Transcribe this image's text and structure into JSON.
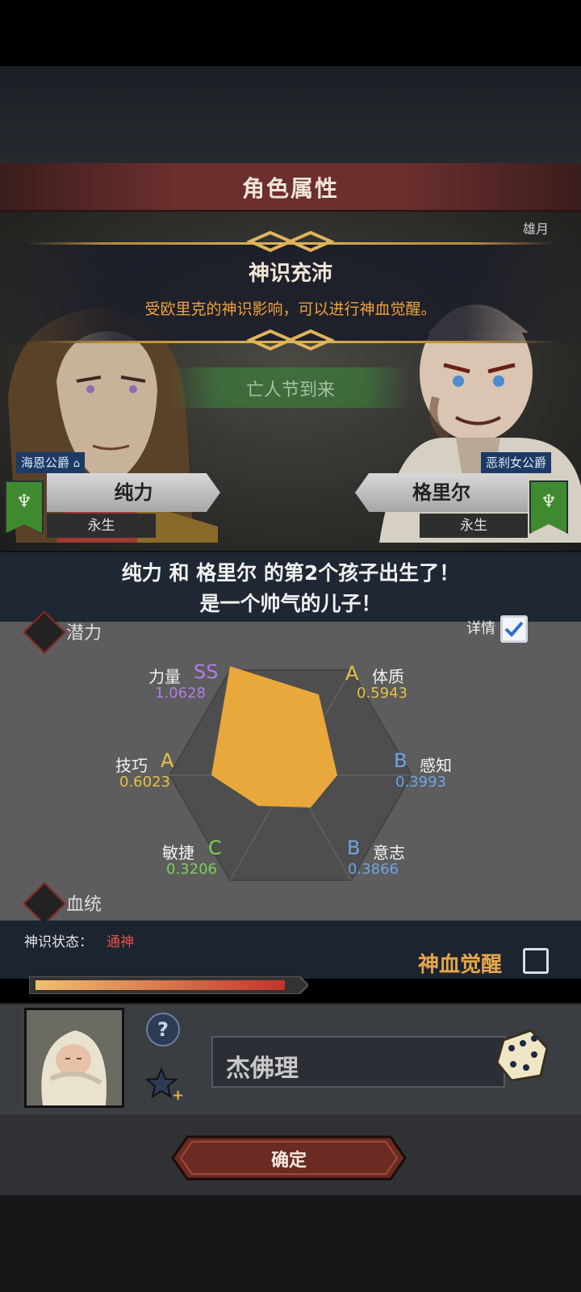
{
  "header": {
    "title": "角色属性"
  },
  "banner": {
    "title": "神识充沛",
    "description": "受欧里克的神识影响，可以进行神血觉醒。"
  },
  "festival": {
    "label": "亡人节到来"
  },
  "scene": {
    "corner_text": "雄月"
  },
  "father": {
    "title": "海恩公爵",
    "name": "纯力",
    "status": "永生"
  },
  "mother": {
    "title": "恶刹女公爵",
    "name": "格里尔",
    "status": "永生"
  },
  "announcement": {
    "line1": "纯力 和 格里尔 的第2个孩子出生了！",
    "line2": "是一个帅气的儿子！"
  },
  "potential": {
    "section_label": "潜力",
    "detail_label": "详情",
    "stats": [
      {
        "name": "力量",
        "grade": "SS",
        "value": "1.0628"
      },
      {
        "name": "体质",
        "grade": "A",
        "value": "0.5943"
      },
      {
        "name": "感知",
        "grade": "B",
        "value": "0.3993"
      },
      {
        "name": "意志",
        "grade": "B",
        "value": "0.3866"
      },
      {
        "name": "敏捷",
        "grade": "C",
        "value": "0.3206"
      },
      {
        "name": "技巧",
        "grade": "A",
        "value": "0.6023"
      }
    ],
    "colors": {
      "SS": "#b07ee8",
      "A": "#e8c04a",
      "B": "#6ea5e6",
      "C": "#7fcf5a",
      "fill": "#e8a83c"
    }
  },
  "bloodline": {
    "section_label": "血统",
    "state_label": "神识状态：",
    "state_value": "通神",
    "awaken_label": "神血觉醒",
    "bar_fill": 0.96
  },
  "child": {
    "name": "杰佛理"
  },
  "footer": {
    "confirm_label": "确定"
  }
}
